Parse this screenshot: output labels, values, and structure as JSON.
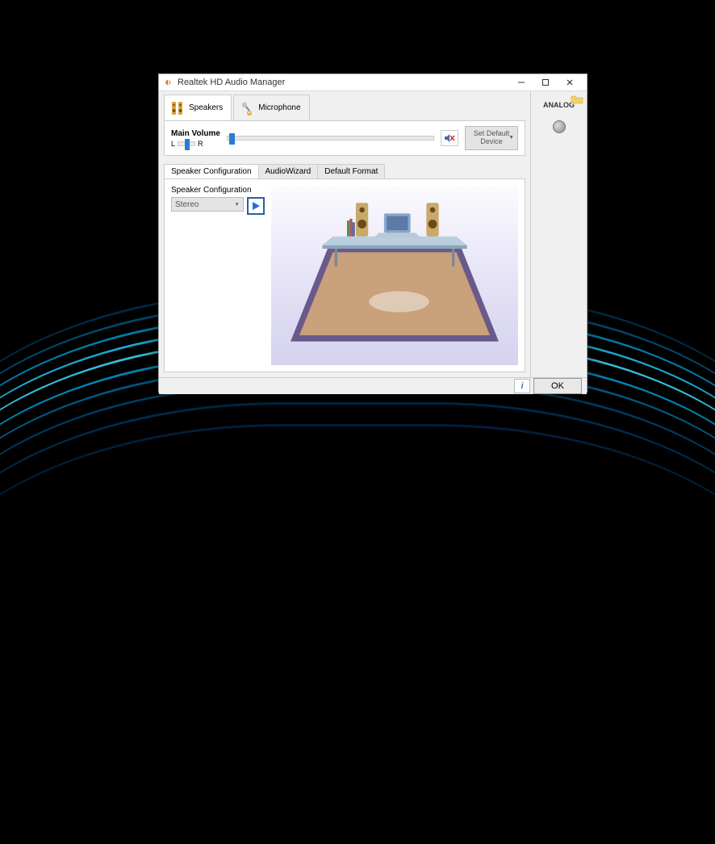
{
  "window": {
    "title": "Realtek HD Audio Manager"
  },
  "deviceTabs": [
    {
      "label": "Speakers",
      "active": true
    },
    {
      "label": "Microphone",
      "active": false
    }
  ],
  "volume": {
    "title": "Main Volume",
    "balanceL": "L",
    "balanceR": "R",
    "setDefault": "Set Default Device"
  },
  "subtabs": [
    {
      "label": "Speaker Configuration",
      "active": true
    },
    {
      "label": "AudioWizard",
      "active": false
    },
    {
      "label": "Default Format",
      "active": false
    }
  ],
  "config": {
    "label": "Speaker Configuration",
    "selected": "Stereo"
  },
  "side": {
    "analog": "ANALOG"
  },
  "buttons": {
    "ok": "OK"
  }
}
